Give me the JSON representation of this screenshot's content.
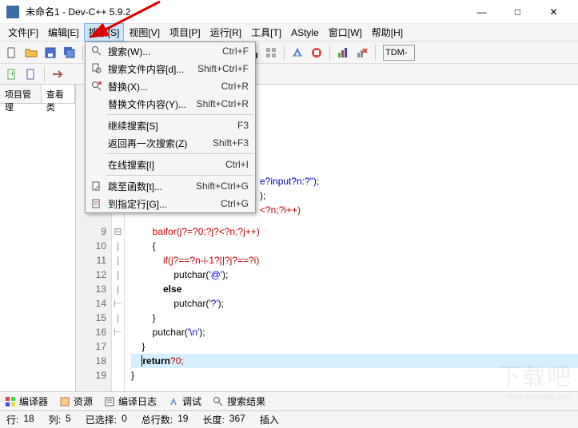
{
  "window": {
    "title": "未命名1 - Dev-C++ 5.9.2",
    "min": "—",
    "max": "□",
    "close": "✕"
  },
  "menu": {
    "file": "文件[F]",
    "edit": "编辑[E]",
    "search": "搜索[S]",
    "view": "视图[V]",
    "project": "项目[P]",
    "run": "运行[R]",
    "tools": "工具[T]",
    "astyle": "AStyle",
    "window": "窗口[W]",
    "help": "帮助[H]"
  },
  "toolbar": {
    "tdm": "TDM-"
  },
  "dropdown": {
    "items": [
      {
        "icon": "search",
        "label": "搜索(W)...",
        "short": "Ctrl+F"
      },
      {
        "icon": "search-file",
        "label": "搜索文件内容[d]...",
        "short": "Shift+Ctrl+F"
      },
      {
        "icon": "replace",
        "label": "替换(X)...",
        "short": "Ctrl+R"
      },
      {
        "icon": "",
        "label": "替换文件内容(Y)...",
        "short": "Shift+Ctrl+R"
      },
      {
        "sep": true
      },
      {
        "icon": "",
        "label": "继续搜索[S]",
        "short": "F3"
      },
      {
        "icon": "",
        "label": "返回再一次搜索(Z)",
        "short": "Shift+F3"
      },
      {
        "sep": true
      },
      {
        "icon": "",
        "label": "在线搜索[I]",
        "short": "Ctrl+I"
      },
      {
        "sep": true
      },
      {
        "icon": "goto",
        "label": "跳至函数[t]...",
        "short": "Shift+Ctrl+G"
      },
      {
        "icon": "goto-line",
        "label": "到指定行[G]...",
        "short": "Ctrl+G"
      }
    ]
  },
  "sidebar": {
    "tab1": "项目管理",
    "tab2": "查看类"
  },
  "gutter": [
    "9",
    "10",
    "11",
    "12",
    "13",
    "14",
    "15",
    "16",
    "17",
    "18",
    "19"
  ],
  "fold": [
    "",
    "⊟",
    "|",
    "|",
    "|",
    "|",
    "⊢",
    "|",
    "⊢",
    "",
    ""
  ],
  "code_partial": {
    "l1": "e?input?n:?\");",
    "l2": ");",
    "l3": "<?n;?i++)"
  },
  "code": {
    "l9": "        baifor(j?=?0;?j?<?n;?j++)",
    "l10": "        {",
    "l11_a": "            if(j?==?n-i-1?||?j?==?i)",
    "l12_a": "                putchar(",
    "l12_s": "'@'",
    "l12_b": ");",
    "l13": "            else",
    "l14_a": "                putchar(",
    "l14_s": "'?'",
    "l14_b": ");",
    "l15": "        }",
    "l16_a": "        putchar(",
    "l16_s": "'\\n'",
    "l16_b": ");",
    "l17": "    }",
    "l18_a": "    ",
    "l18_k": "return",
    "l18_b": "?0;",
    "l19": "}"
  },
  "bottom": {
    "t1": "编译器",
    "t2": "资源",
    "t3": "编译日志",
    "t4": "调试",
    "t5": "搜索结果"
  },
  "status": {
    "row_l": "行:",
    "row_v": "18",
    "col_l": "列:",
    "col_v": "5",
    "sel_l": "已选择:",
    "sel_v": "0",
    "tot_l": "总行数:",
    "tot_v": "19",
    "len_l": "长度:",
    "len_v": "367",
    "ins": "插入"
  },
  "watermark": "下载吧",
  "watermark2": "www.xiazaiba.com"
}
